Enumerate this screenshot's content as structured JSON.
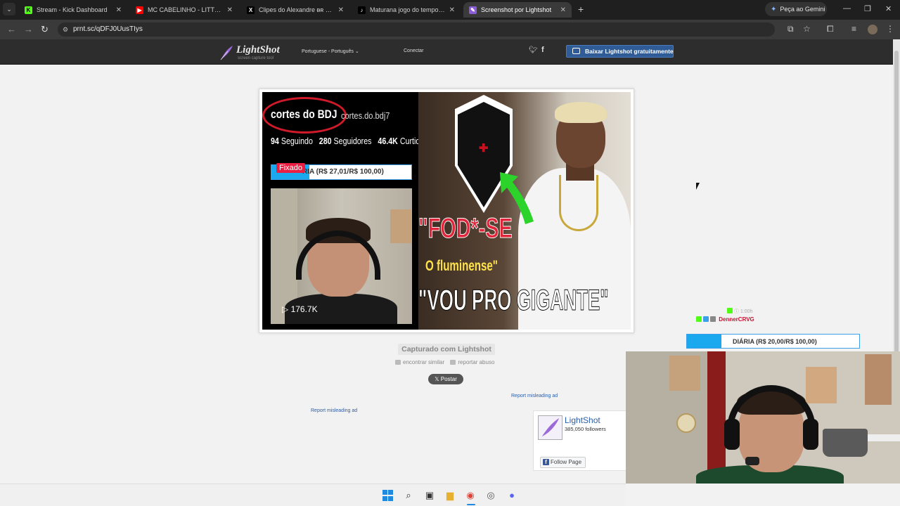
{
  "browser": {
    "tabs": [
      {
        "title": "Stream - Kick Dashboard",
        "favicon_color": "#53fc18",
        "favicon_glyph": "K",
        "active": false
      },
      {
        "title": "MC CABELINHO - LITTLE HAIR",
        "favicon_color": "#ff0000",
        "favicon_glyph": "▶",
        "active": false
      },
      {
        "title": "Clipes do Alexandre ᴃʀ no X: \"Ja",
        "favicon_color": "#000000",
        "favicon_glyph": "X",
        "active": false
      },
      {
        "title": "Maturana jogo do tempo: acert",
        "favicon_color": "#000000",
        "favicon_glyph": "♪",
        "active": false
      },
      {
        "title": "Screenshot por Lightshot",
        "favicon_color": "#8a5cd6",
        "favicon_glyph": "✎",
        "active": true
      }
    ],
    "new_tab_icon": "plus-icon",
    "gemini_label": "Peça ao Gemini",
    "url": "prnt.sc/qDFJ0UusTIys",
    "window_controls": [
      "minimize-icon",
      "restore-icon",
      "close-icon"
    ]
  },
  "lightshot": {
    "logo_name": "LightShot",
    "logo_sub": "screen capture tool",
    "language": "Portuguese - Português",
    "login": "Conectar",
    "download_button": "Baixar Lightshot gratuitamente",
    "captured_label": "Capturado com Lightshot",
    "find_similar": "encontrar similar",
    "report_abuse": "reportar abuso",
    "post_button": "Postar",
    "report_ad_1": "Report misleading ad",
    "report_ad_2": "Report misleading ad",
    "fb_page_name": "LightShot",
    "fb_followers": "385,050 followers",
    "fb_follow_button": "Follow Page"
  },
  "screenshot": {
    "channel_name": "cortes do BDJ",
    "channel_handle": "cortes.do.bdj7",
    "following_count": "94",
    "following_label": "Seguindo",
    "followers_count": "280",
    "followers_label": "Seguidores",
    "likes_count": "46.4K",
    "likes_label": "Curtidas",
    "pinned_label": "Fixado",
    "goal_text": "RIA (R$ 27,01/R$ 100,00)",
    "goal_fraction": 0.27,
    "views": "▷ 176.7K",
    "headline_1": "\"FOD*-SE",
    "headline_2": "O fluminense\"",
    "headline_3": "\"VOU PRO GIGANTE\""
  },
  "overlay": {
    "chat_line_1": "ⓘ 1:00h",
    "chat_user": "DennerCRVG",
    "chat_badges": [
      "#53fc18",
      "#3aa0e8",
      "#888888"
    ],
    "goal_text": "DIÁRIA (R$ 20,00/R$ 100,00)",
    "goal_fraction": 0.2
  },
  "colors": {
    "accent_blue": "#1aa9ef",
    "lightshot_button": "#2f5c96",
    "link": "#2a5ea8",
    "headline_red": "#e0243a",
    "headline_yellow": "#ffe14a"
  }
}
